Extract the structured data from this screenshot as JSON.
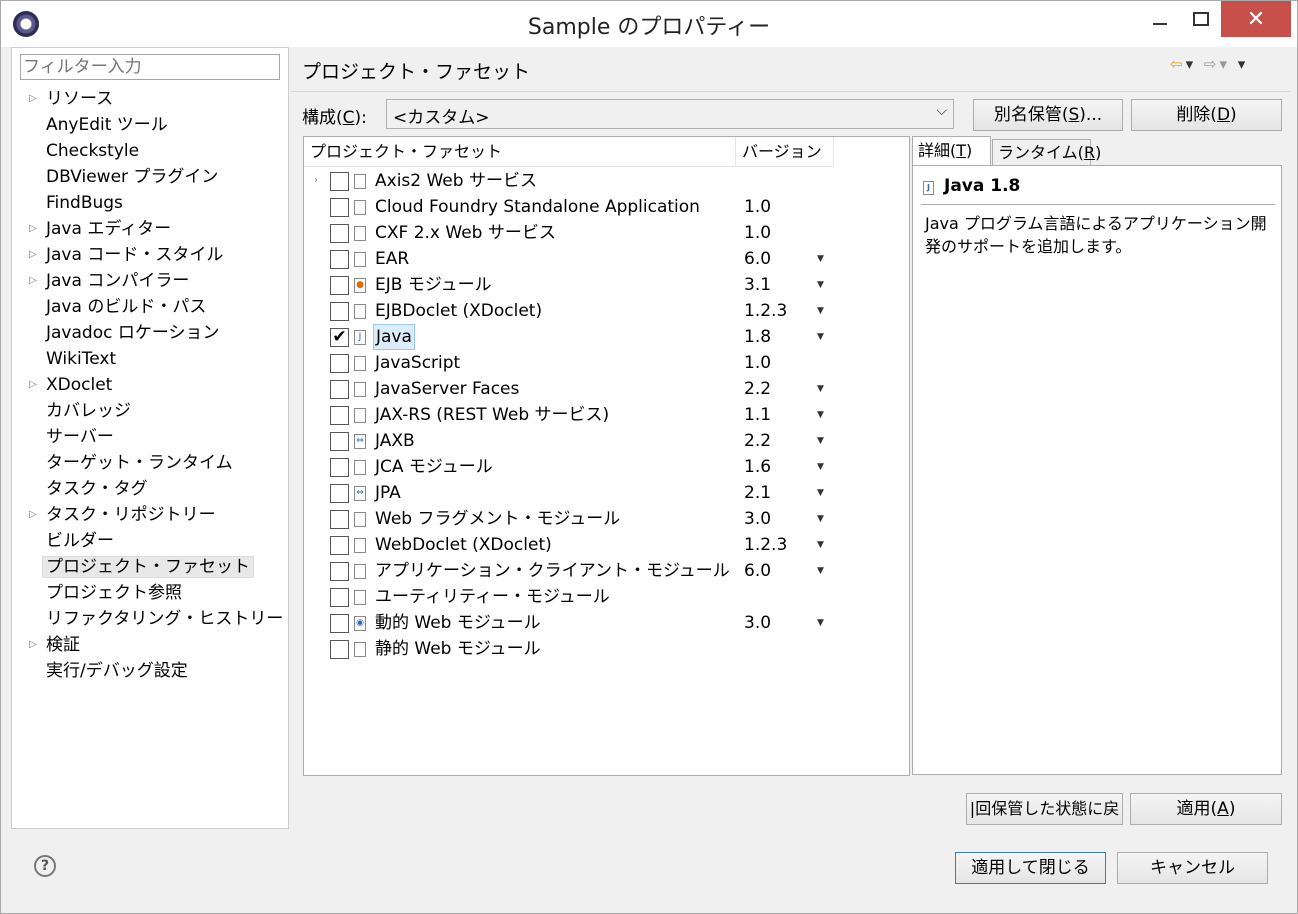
{
  "window": {
    "title": "Sample のプロパティー",
    "close_glyph": "✕"
  },
  "left": {
    "filter_placeholder": "フィルター入力",
    "tree": [
      {
        "label": "リソース",
        "expandable": true
      },
      {
        "label": "AnyEdit ツール",
        "expandable": false
      },
      {
        "label": "Checkstyle",
        "expandable": false
      },
      {
        "label": "DBViewer プラグイン",
        "expandable": false
      },
      {
        "label": "FindBugs",
        "expandable": false
      },
      {
        "label": "Java エディター",
        "expandable": true
      },
      {
        "label": "Java コード・スタイル",
        "expandable": true
      },
      {
        "label": "Java コンパイラー",
        "expandable": true
      },
      {
        "label": "Java のビルド・パス",
        "expandable": false
      },
      {
        "label": "Javadoc ロケーション",
        "expandable": false
      },
      {
        "label": "WikiText",
        "expandable": false
      },
      {
        "label": "XDoclet",
        "expandable": true
      },
      {
        "label": "カバレッジ",
        "expandable": false
      },
      {
        "label": "サーバー",
        "expandable": false
      },
      {
        "label": "ターゲット・ランタイム",
        "expandable": false
      },
      {
        "label": "タスク・タグ",
        "expandable": false
      },
      {
        "label": "タスク・リポジトリー",
        "expandable": true
      },
      {
        "label": "ビルダー",
        "expandable": false
      },
      {
        "label": "プロジェクト・ファセット",
        "expandable": false,
        "selected": true
      },
      {
        "label": "プロジェクト参照",
        "expandable": false
      },
      {
        "label": "リファクタリング・ヒストリー",
        "expandable": false
      },
      {
        "label": "検証",
        "expandable": true
      },
      {
        "label": "実行/デバッグ設定",
        "expandable": false
      }
    ]
  },
  "main": {
    "page_title": "プロジェクト・ファセット",
    "config_label_pre": "構成(",
    "config_label_key": "C",
    "config_label_post": "):",
    "config_value": "<カスタム>",
    "alias_button": {
      "pre": "別名保管(",
      "key": "S",
      "post": ")..."
    },
    "delete_button": {
      "pre": "削除(",
      "key": "D",
      "post": ")"
    },
    "table": {
      "col_facet": "プロジェクト・ファセット",
      "col_version": "バージョン",
      "rows": [
        {
          "name": "Axis2 Web サービス",
          "version": "",
          "checked": false,
          "expandable": true,
          "dropdown": false,
          "icon": "doc"
        },
        {
          "name": "Cloud Foundry Standalone Application",
          "version": "1.0",
          "checked": false,
          "dropdown": false,
          "icon": "doc"
        },
        {
          "name": "CXF 2.x Web サービス",
          "version": "1.0",
          "checked": false,
          "dropdown": false,
          "icon": "doc"
        },
        {
          "name": "EAR",
          "version": "6.0",
          "checked": false,
          "dropdown": true,
          "icon": "doc"
        },
        {
          "name": "EJB モジュール",
          "version": "3.1",
          "checked": false,
          "dropdown": true,
          "icon": "ejb"
        },
        {
          "name": "EJBDoclet (XDoclet)",
          "version": "1.2.3",
          "checked": false,
          "dropdown": true,
          "icon": "doc"
        },
        {
          "name": "Java",
          "version": "1.8",
          "checked": true,
          "selected": true,
          "dropdown": true,
          "icon": "java"
        },
        {
          "name": "JavaScript",
          "version": "1.0",
          "checked": false,
          "dropdown": false,
          "icon": "doc"
        },
        {
          "name": "JavaServer Faces",
          "version": "2.2",
          "checked": false,
          "dropdown": true,
          "icon": "doc"
        },
        {
          "name": "JAX-RS (REST Web サービス)",
          "version": "1.1",
          "checked": false,
          "dropdown": true,
          "icon": "doc"
        },
        {
          "name": "JAXB",
          "version": "2.2",
          "checked": false,
          "dropdown": true,
          "icon": "arrows"
        },
        {
          "name": "JCA モジュール",
          "version": "1.6",
          "checked": false,
          "dropdown": true,
          "icon": "doc"
        },
        {
          "name": "JPA",
          "version": "2.1",
          "checked": false,
          "dropdown": true,
          "icon": "arrows"
        },
        {
          "name": "Web フラグメント・モジュール",
          "version": "3.0",
          "checked": false,
          "dropdown": true,
          "icon": "doc"
        },
        {
          "name": "WebDoclet (XDoclet)",
          "version": "1.2.3",
          "checked": false,
          "dropdown": true,
          "icon": "doc"
        },
        {
          "name": "アプリケーション・クライアント・モジュール",
          "version": "6.0",
          "checked": false,
          "dropdown": true,
          "icon": "doc"
        },
        {
          "name": "ユーティリティー・モジュール",
          "version": "",
          "checked": false,
          "dropdown": false,
          "icon": "doc"
        },
        {
          "name": "動的 Web モジュール",
          "version": "3.0",
          "checked": false,
          "dropdown": true,
          "icon": "web"
        },
        {
          "name": "静的 Web モジュール",
          "version": "",
          "checked": false,
          "dropdown": false,
          "icon": "doc"
        }
      ]
    },
    "tabs": {
      "details": {
        "pre": "詳細(",
        "key": "T",
        "post": ")"
      },
      "runtime": {
        "pre": "ランタイム(",
        "key": "R",
        "post": ")"
      }
    },
    "details": {
      "heading": "Java 1.8",
      "description": "Java プログラム言語によるアプリケーション開発のサポートを追加します。"
    },
    "restore_button": "|回保管した状態に戻",
    "apply_button": {
      "pre": "適用(",
      "key": "A",
      "post": ")"
    }
  },
  "footer": {
    "help": "?",
    "apply_close": "適用して閉じる",
    "cancel": "キャンセル"
  }
}
